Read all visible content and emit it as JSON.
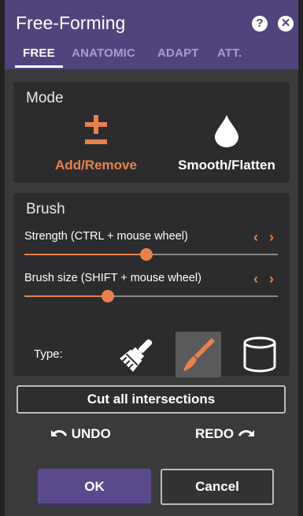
{
  "window": {
    "title": "Free-Forming",
    "help_icon": "question-circle-icon",
    "close_icon": "close-circle-icon"
  },
  "tabs": [
    {
      "label": "FREE",
      "active": true
    },
    {
      "label": "ANATOMIC",
      "active": false
    },
    {
      "label": "ADAPT",
      "active": false
    },
    {
      "label": "ATT.",
      "active": false
    }
  ],
  "mode": {
    "title": "Mode",
    "options": [
      {
        "label": "Add/Remove",
        "icon": "plus-minus-icon",
        "selected": true
      },
      {
        "label": "Smooth/Flatten",
        "icon": "droplet-icon",
        "selected": false
      }
    ]
  },
  "brush": {
    "title": "Brush",
    "strength": {
      "label": "Strength (CTRL + mouse wheel)",
      "value": 0.48
    },
    "size": {
      "label": "Brush size (SHIFT + mouse wheel)",
      "value": 0.33
    },
    "type_label": "Type:",
    "types": [
      {
        "icon": "paint-brush-icon",
        "selected": false
      },
      {
        "icon": "brush-icon",
        "selected": true
      },
      {
        "icon": "cylinder-icon",
        "selected": false
      }
    ]
  },
  "actions": {
    "cut_label": "Cut all intersections",
    "undo_label": "UNDO",
    "redo_label": "REDO",
    "ok_label": "OK",
    "cancel_label": "Cancel"
  },
  "colors": {
    "header": "#51447d",
    "accent": "#e8814c",
    "ok_button": "#5a4a8c"
  }
}
